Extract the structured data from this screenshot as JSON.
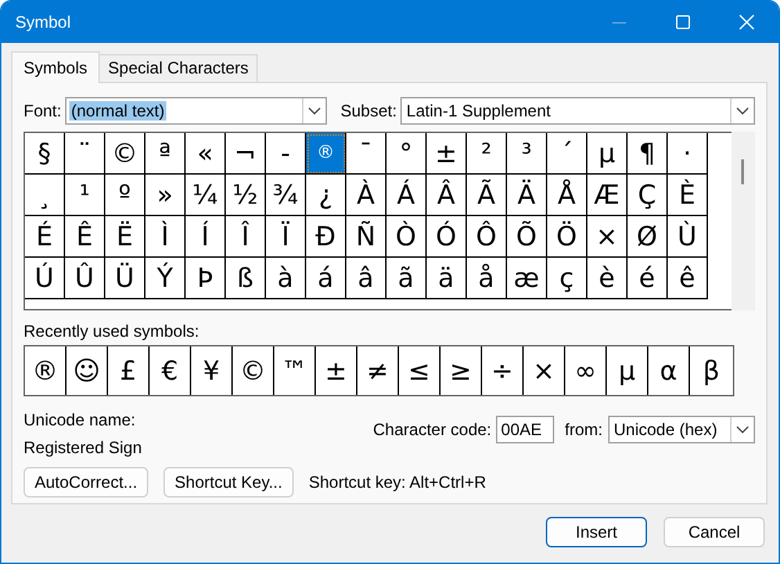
{
  "window": {
    "title": "Symbol"
  },
  "tabs": [
    {
      "label": "Symbols",
      "selected": true
    },
    {
      "label": "Special Characters",
      "selected": false
    }
  ],
  "font": {
    "label": "Font:",
    "value": "(normal text)"
  },
  "subset": {
    "label": "Subset:",
    "value": "Latin-1 Supplement"
  },
  "grid": {
    "cells": [
      {
        "char": "§",
        "selected": false
      },
      {
        "char": "¨",
        "selected": false
      },
      {
        "char": "©",
        "selected": false
      },
      {
        "char": "ª",
        "selected": false
      },
      {
        "char": "«",
        "selected": false
      },
      {
        "char": "¬",
        "selected": false
      },
      {
        "char": "-",
        "selected": false
      },
      {
        "char": "®",
        "selected": true
      },
      {
        "char": "¯",
        "selected": false
      },
      {
        "char": "°",
        "selected": false
      },
      {
        "char": "±",
        "selected": false
      },
      {
        "char": "²",
        "selected": false
      },
      {
        "char": "³",
        "selected": false
      },
      {
        "char": "´",
        "selected": false
      },
      {
        "char": "µ",
        "selected": false
      },
      {
        "char": "¶",
        "selected": false
      },
      {
        "char": "·",
        "selected": false
      },
      {
        "char": "¸",
        "selected": false
      },
      {
        "char": "¹",
        "selected": false
      },
      {
        "char": "º",
        "selected": false
      },
      {
        "char": "»",
        "selected": false
      },
      {
        "char": "¼",
        "selected": false
      },
      {
        "char": "½",
        "selected": false
      },
      {
        "char": "¾",
        "selected": false
      },
      {
        "char": "¿",
        "selected": false
      },
      {
        "char": "À",
        "selected": false
      },
      {
        "char": "Á",
        "selected": false
      },
      {
        "char": "Â",
        "selected": false
      },
      {
        "char": "Ã",
        "selected": false
      },
      {
        "char": "Ä",
        "selected": false
      },
      {
        "char": "Å",
        "selected": false
      },
      {
        "char": "Æ",
        "selected": false
      },
      {
        "char": "Ç",
        "selected": false
      },
      {
        "char": "È",
        "selected": false
      },
      {
        "char": "É",
        "selected": false
      },
      {
        "char": "Ê",
        "selected": false
      },
      {
        "char": "Ë",
        "selected": false
      },
      {
        "char": "Ì",
        "selected": false
      },
      {
        "char": "Í",
        "selected": false
      },
      {
        "char": "Î",
        "selected": false
      },
      {
        "char": "Ï",
        "selected": false
      },
      {
        "char": "Ð",
        "selected": false
      },
      {
        "char": "Ñ",
        "selected": false
      },
      {
        "char": "Ò",
        "selected": false
      },
      {
        "char": "Ó",
        "selected": false
      },
      {
        "char": "Ô",
        "selected": false
      },
      {
        "char": "Õ",
        "selected": false
      },
      {
        "char": "Ö",
        "selected": false
      },
      {
        "char": "×",
        "selected": false
      },
      {
        "char": "Ø",
        "selected": false
      },
      {
        "char": "Ù",
        "selected": false
      },
      {
        "char": "Ú",
        "selected": false
      },
      {
        "char": "Û",
        "selected": false
      },
      {
        "char": "Ü",
        "selected": false
      },
      {
        "char": "Ý",
        "selected": false
      },
      {
        "char": "Þ",
        "selected": false
      },
      {
        "char": "ß",
        "selected": false
      },
      {
        "char": "à",
        "selected": false
      },
      {
        "char": "á",
        "selected": false
      },
      {
        "char": "â",
        "selected": false
      },
      {
        "char": "ã",
        "selected": false
      },
      {
        "char": "ä",
        "selected": false
      },
      {
        "char": "å",
        "selected": false
      },
      {
        "char": "æ",
        "selected": false
      },
      {
        "char": "ç",
        "selected": false
      },
      {
        "char": "è",
        "selected": false
      },
      {
        "char": "é",
        "selected": false
      },
      {
        "char": "ê",
        "selected": false
      }
    ]
  },
  "recent": {
    "label": "Recently used symbols:",
    "symbols": [
      "®",
      "☺",
      "£",
      "€",
      "¥",
      "©",
      "™",
      "±",
      "≠",
      "≤",
      "≥",
      "÷",
      "×",
      "∞",
      "µ",
      "α",
      "β"
    ]
  },
  "unicode_name": {
    "label": "Unicode name:",
    "value": "Registered Sign"
  },
  "character_code": {
    "label": "Character code:",
    "value": "00AE"
  },
  "from": {
    "label": "from:",
    "value": "Unicode (hex)"
  },
  "buttons": [
    "AutoCorrect...",
    "Shortcut Key..."
  ],
  "shortcut_text": "Shortcut key: Alt+Ctrl+R",
  "footer_buttons": [
    {
      "label": "Insert",
      "default": true
    },
    {
      "label": "Cancel",
      "default": false
    }
  ]
}
